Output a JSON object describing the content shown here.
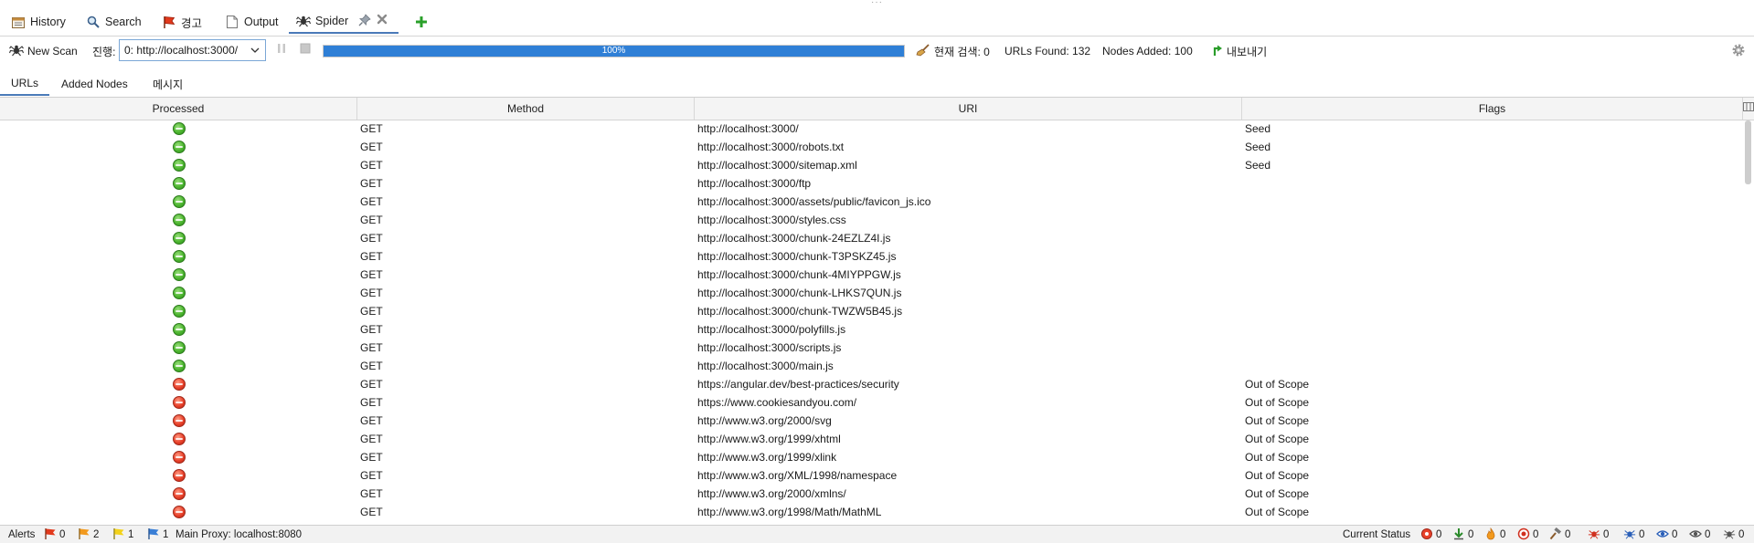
{
  "top_tabs": [
    {
      "label": "History",
      "icon": "history-icon"
    },
    {
      "label": "Search",
      "icon": "search-icon"
    },
    {
      "label": "경고",
      "icon": "alerts-flag-icon"
    },
    {
      "label": "Output",
      "icon": "output-icon"
    },
    {
      "label": "Spider",
      "icon": "spider-icon",
      "active": true
    }
  ],
  "toolbar": {
    "new_scan_label": "New Scan",
    "progress_label": "진행:",
    "progress_select_value": "0: http://localhost:3000/",
    "progress_percent": 100,
    "progress_text": "100%",
    "current_scans": "현재 검색: 0",
    "urls_found": "URLs Found: 132",
    "nodes_added": "Nodes Added: 100",
    "export_label": "내보내기"
  },
  "sub_tabs": [
    {
      "label": "URLs",
      "active": true
    },
    {
      "label": "Added Nodes"
    },
    {
      "label": "메시지"
    }
  ],
  "table": {
    "headers": [
      "Processed",
      "Method",
      "URI",
      "Flags"
    ],
    "rows": [
      {
        "status": "ok",
        "method": "GET",
        "uri": "http://localhost:3000/",
        "flags": "Seed"
      },
      {
        "status": "ok",
        "method": "GET",
        "uri": "http://localhost:3000/robots.txt",
        "flags": "Seed"
      },
      {
        "status": "ok",
        "method": "GET",
        "uri": "http://localhost:3000/sitemap.xml",
        "flags": "Seed"
      },
      {
        "status": "ok",
        "method": "GET",
        "uri": "http://localhost:3000/ftp",
        "flags": ""
      },
      {
        "status": "ok",
        "method": "GET",
        "uri": "http://localhost:3000/assets/public/favicon_js.ico",
        "flags": ""
      },
      {
        "status": "ok",
        "method": "GET",
        "uri": "http://localhost:3000/styles.css",
        "flags": ""
      },
      {
        "status": "ok",
        "method": "GET",
        "uri": "http://localhost:3000/chunk-24EZLZ4I.js",
        "flags": ""
      },
      {
        "status": "ok",
        "method": "GET",
        "uri": "http://localhost:3000/chunk-T3PSKZ45.js",
        "flags": ""
      },
      {
        "status": "ok",
        "method": "GET",
        "uri": "http://localhost:3000/chunk-4MIYPPGW.js",
        "flags": ""
      },
      {
        "status": "ok",
        "method": "GET",
        "uri": "http://localhost:3000/chunk-LHKS7QUN.js",
        "flags": ""
      },
      {
        "status": "ok",
        "method": "GET",
        "uri": "http://localhost:3000/chunk-TWZW5B45.js",
        "flags": ""
      },
      {
        "status": "ok",
        "method": "GET",
        "uri": "http://localhost:3000/polyfills.js",
        "flags": ""
      },
      {
        "status": "ok",
        "method": "GET",
        "uri": "http://localhost:3000/scripts.js",
        "flags": ""
      },
      {
        "status": "ok",
        "method": "GET",
        "uri": "http://localhost:3000/main.js",
        "flags": ""
      },
      {
        "status": "ko",
        "method": "GET",
        "uri": "https://angular.dev/best-practices/security",
        "flags": "Out of Scope"
      },
      {
        "status": "ko",
        "method": "GET",
        "uri": "https://www.cookiesandyou.com/",
        "flags": "Out of Scope"
      },
      {
        "status": "ko",
        "method": "GET",
        "uri": "http://www.w3.org/2000/svg",
        "flags": "Out of Scope"
      },
      {
        "status": "ko",
        "method": "GET",
        "uri": "http://www.w3.org/1999/xhtml",
        "flags": "Out of Scope"
      },
      {
        "status": "ko",
        "method": "GET",
        "uri": "http://www.w3.org/1999/xlink",
        "flags": "Out of Scope"
      },
      {
        "status": "ko",
        "method": "GET",
        "uri": "http://www.w3.org/XML/1998/namespace",
        "flags": "Out of Scope"
      },
      {
        "status": "ko",
        "method": "GET",
        "uri": "http://www.w3.org/2000/xmlns/",
        "flags": "Out of Scope"
      },
      {
        "status": "ko",
        "method": "GET",
        "uri": "http://www.w3.org/1998/Math/MathML",
        "flags": "Out of Scope"
      }
    ]
  },
  "statusbar": {
    "alerts_label": "Alerts",
    "alert_high": "0",
    "alert_medium": "2",
    "alert_low": "1",
    "alert_info": "1",
    "main_proxy": "Main Proxy: localhost:8080",
    "current_status_label": "Current Status",
    "status_counts": [
      "0",
      "0",
      "0",
      "0",
      "0",
      "0",
      "0",
      "0",
      "0"
    ]
  },
  "colors": {
    "progress_fill": "#2f7fd6",
    "processed_ok": "#4cb52f",
    "processed_out_of_scope": "#e8412a",
    "tab_underline": "#4a7ab8"
  }
}
